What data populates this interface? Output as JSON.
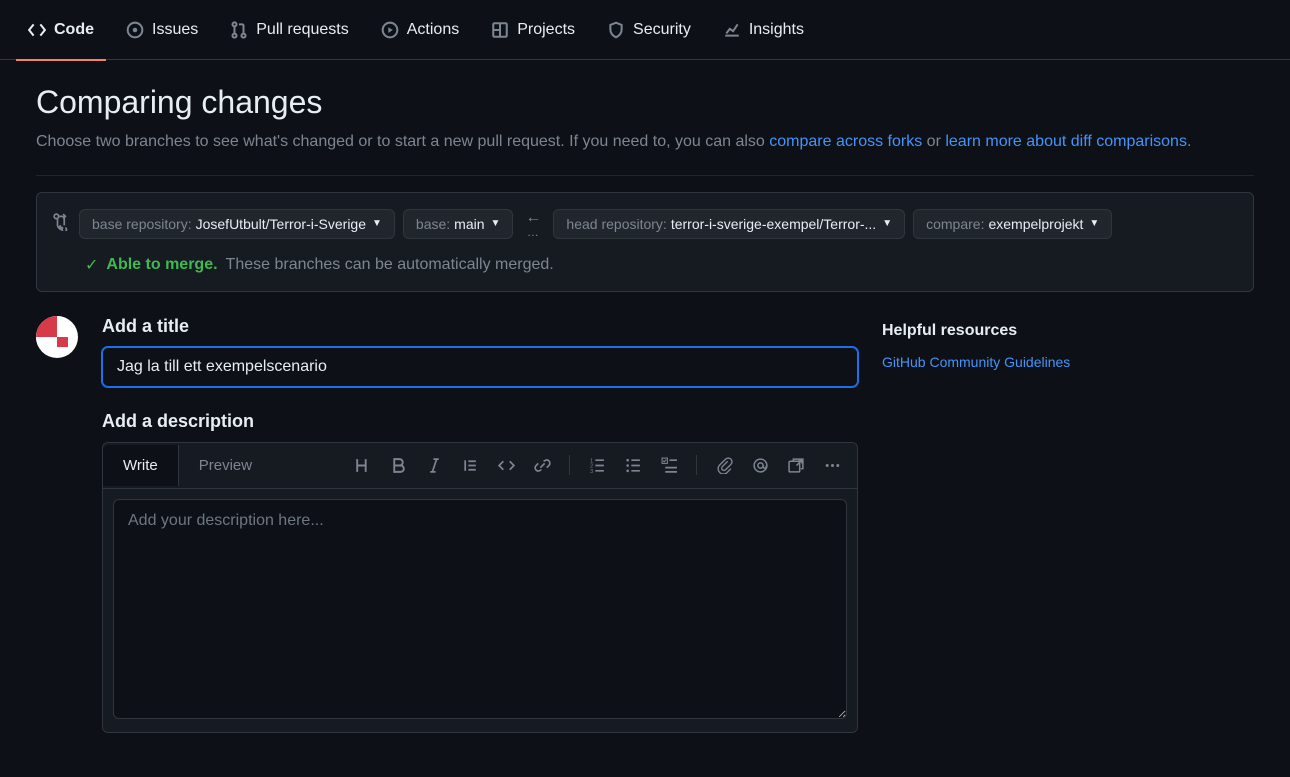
{
  "nav": {
    "code": "Code",
    "issues": "Issues",
    "pulls": "Pull requests",
    "actions": "Actions",
    "projects": "Projects",
    "security": "Security",
    "insights": "Insights"
  },
  "page": {
    "title": "Comparing changes",
    "subtitle_pre": "Choose two branches to see what's changed or to start a new pull request. If you need to, you can also ",
    "link_forks": "compare across forks",
    "subtitle_or": " or ",
    "link_learn": "learn more about diff comparisons",
    "subtitle_end": "."
  },
  "compare": {
    "base_repo_label": "base repository: ",
    "base_repo_value": "JosefUtbult/Terror-i-Sverige",
    "base_label": "base: ",
    "base_value": "main",
    "head_repo_label": "head repository: ",
    "head_repo_value": "terror-i-sverige-exempel/Terror-...",
    "compare_label": "compare: ",
    "compare_value": "exempelprojekt",
    "merge_able": "Able to merge.",
    "merge_rest": "These branches can be automatically merged."
  },
  "form": {
    "title_label": "Add a title",
    "title_value": "Jag la till ett exempelscenario",
    "desc_label": "Add a description",
    "tab_write": "Write",
    "tab_preview": "Preview",
    "desc_placeholder": "Add your description here..."
  },
  "sidebar": {
    "heading": "Helpful resources",
    "link": "GitHub Community Guidelines"
  }
}
